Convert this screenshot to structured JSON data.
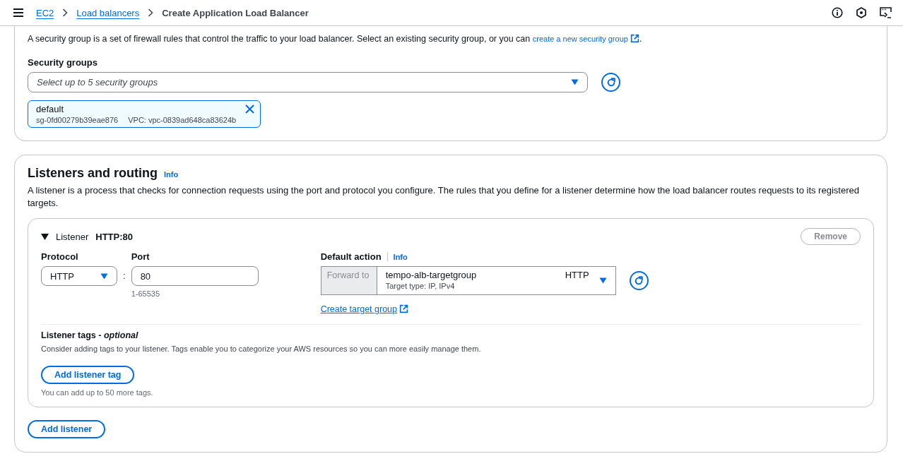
{
  "breadcrumbs": [
    {
      "label": "EC2",
      "kind": "link"
    },
    {
      "label": "Load balancers",
      "kind": "link"
    },
    {
      "label": "Create Application Load Balancer",
      "kind": "current"
    }
  ],
  "security_groups": {
    "description": "A security group is a set of firewall rules that control the traffic to your load balancer. Select an existing security group, or you can ",
    "link": "create a new security group",
    "description_end": ".",
    "field_label": "Security groups",
    "select": {
      "placeholder": "Select up to 5 security groups"
    },
    "tokens": [
      {
        "name": "default",
        "id": "sg-0fd00279b39eae876",
        "vpc": "VPC: vpc-0839ad648ca83624b"
      }
    ]
  },
  "listeners_routing": {
    "title": "Listeners and routing",
    "info": "Info",
    "description": "A listener is a process that checks for connection requests using the port and protocol you configure. The rules that you define for a listener determine how the load balancer routes requests to its registered targets.",
    "listeners": [
      {
        "expanded": true,
        "label": "Listener",
        "name": "HTTP:80",
        "remove_button": {
          "label": "Remove",
          "disabled": true
        },
        "protocol_label": "Protocol",
        "protocol": "HTTP",
        "separator": ":",
        "port_label": "Port",
        "port": "80",
        "port_hint": "1-65535",
        "default_action_label": "Default action",
        "default_action_info": "Info",
        "action": "Forward to",
        "target_group": "tempo-alb-targetgroup",
        "target_protocol": "HTTP",
        "target_type": "Target type: IP, IPv4",
        "create_link": "Create target group",
        "tags_title": "Listener tags - *optional*",
        "tags_description": "Consider adding tags to your listener. Tags enable you to categorize your AWS resources so you can more easily manage them.",
        "add_tag_button": "Add listener tag",
        "tags_hint": "You can add up to 50 more tags."
      }
    ],
    "add_listener_button": "Add listener"
  }
}
